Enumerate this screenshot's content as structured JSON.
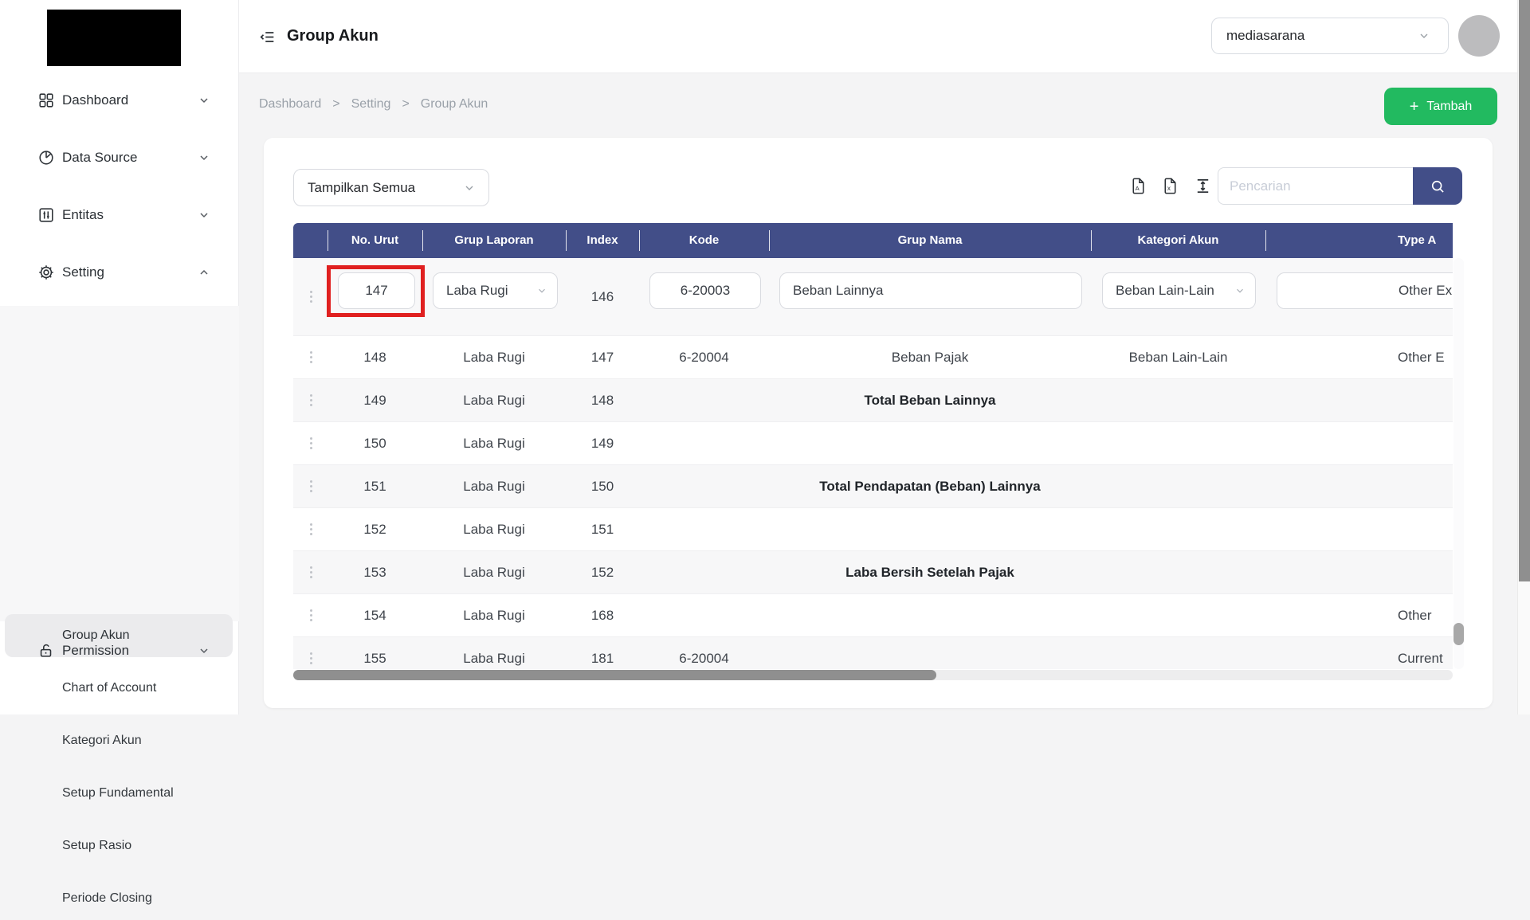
{
  "colors": {
    "accent_navy": "#424e88",
    "accent_green": "#22ba60",
    "annotation_red": "#e02020",
    "zebra_gray": "#f7f7f8"
  },
  "topbar": {
    "title": "Group Akun",
    "tenant_value": "mediasarana"
  },
  "sidebar": {
    "items": [
      {
        "label": "Dashboard",
        "icon": "dashboard-icon"
      },
      {
        "label": "Data Source",
        "icon": "pie-chart-icon"
      },
      {
        "label": "Entitas",
        "icon": "sliders-icon"
      },
      {
        "label": "Setting",
        "icon": "gear-icon"
      },
      {
        "label": "Permission",
        "icon": "lock-icon"
      }
    ],
    "setting_subitems": [
      {
        "label": "Group Akun",
        "active": true
      },
      {
        "label": "Chart of Account"
      },
      {
        "label": "Kategori Akun"
      },
      {
        "label": "Setup Fundamental"
      },
      {
        "label": "Setup Rasio"
      },
      {
        "label": "Periode Closing"
      }
    ]
  },
  "breadcrumb": {
    "items": [
      "Dashboard",
      "Setting",
      "Group Akun"
    ],
    "separator": ">"
  },
  "actions": {
    "tambah_plus": "+",
    "tambah_label": "Tambah"
  },
  "toolbar": {
    "filter_value": "Tampilkan Semua",
    "export_icons": [
      "pdf-file-icon",
      "excel-file-icon",
      "fit-height-icon"
    ],
    "search_placeholder": "Pencarian"
  },
  "table": {
    "columns": [
      "No. Urut",
      "Grup Laporan",
      "Index",
      "Kode",
      "Grup Nama",
      "Kategori Akun",
      "Type A"
    ],
    "edit_row": {
      "no_urut_value": "147",
      "grup_laporan_value": "Laba Rugi",
      "index_text": "146",
      "kode_value": "6-20003",
      "grup_nama_value": "Beban Lainnya",
      "kategori_value": "Beban Lain-Lain",
      "type_value": "Other Ex"
    },
    "rows": [
      {
        "no": "148",
        "laporan": "Laba Rugi",
        "index": "147",
        "kode": "6-20004",
        "nama": "Beban Pajak",
        "kategori": "Beban Lain-Lain",
        "type": "Other E"
      },
      {
        "no": "149",
        "laporan": "Laba Rugi",
        "index": "148",
        "kode": "",
        "nama": "Total Beban Lainnya",
        "kategori": "",
        "type": ""
      },
      {
        "no": "150",
        "laporan": "Laba Rugi",
        "index": "149",
        "kode": "",
        "nama": "",
        "kategori": "",
        "type": ""
      },
      {
        "no": "151",
        "laporan": "Laba Rugi",
        "index": "150",
        "kode": "",
        "nama": "Total Pendapatan (Beban) Lainnya",
        "kategori": "",
        "type": ""
      },
      {
        "no": "152",
        "laporan": "Laba Rugi",
        "index": "151",
        "kode": "",
        "nama": "",
        "kategori": "",
        "type": ""
      },
      {
        "no": "153",
        "laporan": "Laba Rugi",
        "index": "152",
        "kode": "",
        "nama": "Laba Bersih Setelah Pajak",
        "kategori": "",
        "type": ""
      },
      {
        "no": "154",
        "laporan": "Laba Rugi",
        "index": "168",
        "kode": "",
        "nama": "",
        "kategori": "",
        "type": "Other"
      },
      {
        "no": "155",
        "laporan": "Laba Rugi",
        "index": "181",
        "kode": "6-20004",
        "nama": "",
        "kategori": "",
        "type": "Current"
      }
    ]
  }
}
